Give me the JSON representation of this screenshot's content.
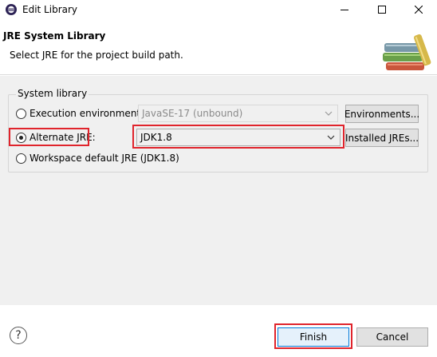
{
  "window": {
    "title": "Edit Library",
    "minimize_icon": "minimize-icon",
    "maximize_icon": "maximize-icon",
    "close_icon": "close-icon"
  },
  "banner": {
    "title": "JRE System Library",
    "description": "Select JRE for the project build path.",
    "graphic_icon": "books-icon"
  },
  "system_library": {
    "legend": "System library",
    "options": [
      {
        "label": "Execution environment:",
        "selected": false
      },
      {
        "label": "Alternate JRE:",
        "selected": true
      },
      {
        "label": "Workspace default JRE (JDK1.8)",
        "selected": false
      }
    ],
    "execution_environment_value": "JavaSE-17 (unbound)",
    "alternate_jre_value": "JDK1.8",
    "environments_button": "Environments...",
    "installed_jres_button": "Installed JREs..."
  },
  "footer": {
    "help_label": "?",
    "finish_label": "Finish",
    "cancel_label": "Cancel"
  },
  "colors": {
    "highlight": "#e0242c",
    "default_button_border": "#0078d7"
  }
}
